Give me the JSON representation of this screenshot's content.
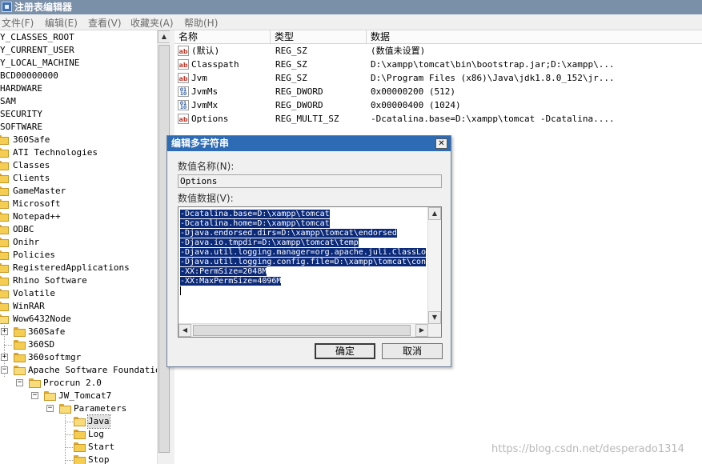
{
  "window": {
    "title": "注册表编辑器"
  },
  "menu": [
    "文件(F)",
    "编辑(E)",
    "查看(V)",
    "收藏夹(A)",
    "帮助(H)"
  ],
  "tree": {
    "roots": [
      "Y_CLASSES_ROOT",
      "Y_CURRENT_USER",
      "Y_LOCAL_MACHINE",
      "BCD00000000",
      "HARDWARE",
      "SAM",
      "SECURITY",
      "SOFTWARE"
    ],
    "software_children": [
      "360Safe",
      "ATI Technologies",
      "Classes",
      "Clients",
      "GameMaster",
      "Microsoft",
      "Notepad++",
      "ODBC",
      "Onihr",
      "Policies",
      "RegisteredApplications",
      "Rhino Software",
      "Volatile",
      "WinRAR",
      "Wow6432Node"
    ],
    "wow_children": [
      "360Safe",
      "360SD",
      "360softmgr",
      "Apache Software Foundation"
    ],
    "procrun": "Procrun 2.0",
    "jw": "JW_Tomcat7",
    "parameters": "Parameters",
    "param_children": [
      "Java",
      "Log",
      "Start",
      "Stop"
    ]
  },
  "list": {
    "headers": [
      "名称",
      "类型",
      "数据"
    ],
    "rows": [
      {
        "icon": "ab",
        "name": "(默认)",
        "type": "REG_SZ",
        "data": "(数值未设置)"
      },
      {
        "icon": "ab",
        "name": "Classpath",
        "type": "REG_SZ",
        "data": "D:\\xampp\\tomcat\\bin\\bootstrap.jar;D:\\xampp\\..."
      },
      {
        "icon": "ab",
        "name": "Jvm",
        "type": "REG_SZ",
        "data": "D:\\Program Files (x86)\\Java\\jdk1.8.0_152\\jr..."
      },
      {
        "icon": "bin",
        "name": "JvmMs",
        "type": "REG_DWORD",
        "data": "0x00000200 (512)"
      },
      {
        "icon": "bin",
        "name": "JvmMx",
        "type": "REG_DWORD",
        "data": "0x00000400 (1024)"
      },
      {
        "icon": "ab",
        "name": "Options",
        "type": "REG_MULTI_SZ",
        "data": "-Dcatalina.base=D:\\xampp\\tomcat -Dcatalina...."
      }
    ]
  },
  "dialog": {
    "title": "编辑多字符串",
    "close": "✕",
    "name_label": "数值名称(N):",
    "name_value": "Options",
    "data_label": "数值数据(V):",
    "data_lines": [
      "-Dcatalina.base=D:\\xampp\\tomcat",
      "-Dcatalina.home=D:\\xampp\\tomcat",
      "-Djava.endorsed.dirs=D:\\xampp\\tomcat\\endorsed",
      "-Djava.io.tmpdir=D:\\xampp\\tomcat\\temp",
      "-Djava.util.logging.manager=org.apache.juli.ClassLo",
      "-Djava.util.logging.config.file=D:\\xampp\\tomcat\\con",
      "-XX:PermSize=2048M",
      "-XX:MaxPermSize=4096M"
    ],
    "ok": "确定",
    "cancel": "取消"
  },
  "scroll": {
    "up": "▲",
    "down": "▼",
    "left": "◀",
    "right": "▶"
  },
  "watermark": "https://blog.csdn.net/desperado1314"
}
